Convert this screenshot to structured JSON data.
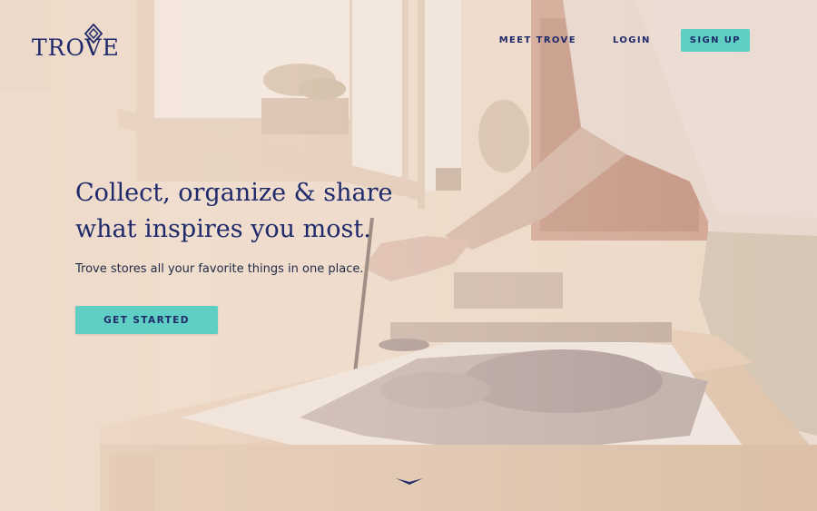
{
  "brand": {
    "name": "TROVE",
    "logo_icon": "diamond-icon",
    "color": "#1f2a6b"
  },
  "nav": {
    "items": [
      "MEET TROVE",
      "LOGIN"
    ],
    "signup_label": "SIGN UP"
  },
  "hero": {
    "title": "Collect, organize & share what inspires you most.",
    "subtitle": "Trove stores all your favorite things in one place.",
    "cta_label": "GET STARTED",
    "scroll_icon": "chevron-down-icon",
    "background_image": "artist-painting-in-studio"
  },
  "colors": {
    "accent": "#5ecfc2",
    "primary_text": "#1f2a6b",
    "overlay": "#f4e2d3"
  }
}
